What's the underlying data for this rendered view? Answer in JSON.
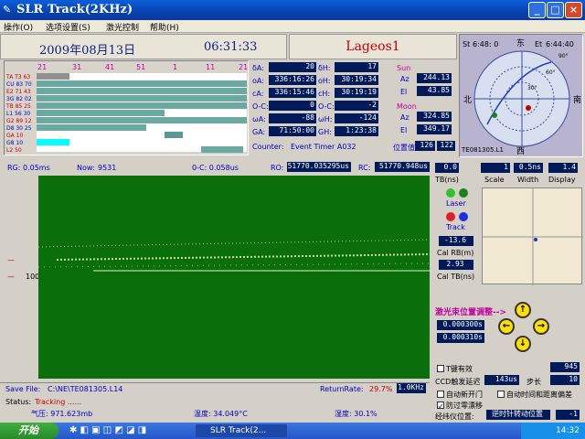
{
  "window": {
    "title": "SLR Track(2KHz)"
  },
  "menu": [
    "操作(O)",
    "选项设置(S)",
    "激光控制",
    "帮助(H)"
  ],
  "header": {
    "date": "2009年08月13日",
    "time": "06:31:33",
    "satellite": "Lageos1"
  },
  "pass_chart": {
    "ticks": [
      "21",
      "31",
      "41",
      "51",
      "1",
      "11",
      "21"
    ],
    "stations": [
      "TA T3 63",
      "CU 83 70",
      "E2 71 43",
      "3G 82 02",
      "TB 85 25",
      "L1 56 30",
      "G2 89 12",
      "D8 30 25",
      "GA 10",
      "G8 10",
      "L2 50"
    ]
  },
  "params": {
    "dA": "20",
    "dH": "17",
    "oA": "336:16:26",
    "oH": "30:19:34",
    "cA": "336:15:46",
    "cH": "30:19:19",
    "OC1": "0",
    "OC2": "-2",
    "wA": "-88",
    "wH": "-124",
    "GA": "71:50:00",
    "GH": "1:23:38",
    "counter_label": "Counter:",
    "counter_value": "Event Timer A032",
    "pos_label": "位置值",
    "pos1": "126",
    "pos2": "122",
    "labels": {
      "dA": "δA:",
      "dH": "δH:",
      "oA": "oA:",
      "oH": "oH:",
      "cA": "cA:",
      "cH": "cH:",
      "OC1": "O-C:",
      "OC2": "O-C:",
      "wA": "ωA:",
      "wH": "ωH:",
      "GA": "GA:",
      "GH": "GH:"
    }
  },
  "sun": {
    "title": "Sun",
    "az_label": "Az",
    "az": "244.13",
    "el_label": "El",
    "el": "43.85"
  },
  "moon": {
    "title": "Moon",
    "az_label": "Az",
    "az": "324.85",
    "el_label": "El",
    "el": "349.17"
  },
  "polar": {
    "st": "St",
    "st_val": "6:48: 0",
    "et": "Et",
    "et_val": "6:44:40",
    "n": "北",
    "s": "南",
    "e": "东",
    "w": "西",
    "footer": "TE081305.L1",
    "rings": [
      "30°",
      "60°",
      "90°"
    ]
  },
  "track_header": {
    "rg": "RG: 0.05ms",
    "now_label": "Now:",
    "now": "9531",
    "oc": "0-C: 0.058us",
    "ro_label": "RO:",
    "ro": "51770.035295us",
    "rc_label": "RC:",
    "rc": "51770.948us"
  },
  "plot": {
    "ytick": "100"
  },
  "right": {
    "tbm": "0.0",
    "scale_v": "1",
    "width_v": "0.5ns",
    "display_v": "1.4",
    "tbm_label": "TB(ns)",
    "scale_label": "Scale",
    "width_label": "Width",
    "display_label": "Display",
    "laser_label": "Laser",
    "track_label": "Track",
    "cal_rb": "-13.6",
    "cal_rb_label": "Cal RB(m)",
    "cal_tb": "2.93",
    "cal_tb_label": "Cal TB(ns)",
    "beam_label": "激光束位置调整-->",
    "beam1": "0.000300s",
    "beam2": "0.000310s",
    "valid_label": "T键有效",
    "valid_val": "945",
    "ccd_label": "CCD触发延迟",
    "ccd_val": "143us",
    "step_label": "步长",
    "step_val": "10",
    "auto1": "自动新开门",
    "auto2": "自动时间和距离偏差",
    "prevent": "防过零漂移",
    "pos_label": "经纬仪位置:",
    "pos_btn": "逆时针转动位置",
    "pos_val": "-1"
  },
  "status": {
    "save_label": "Save File:",
    "save_path": "C:\\NE\\TE081305.L14",
    "return_label": "ReturnRate:",
    "return_val": "29.7%",
    "rate": "1.0KHz",
    "status_label": "Status:",
    "status_val": "Tracking ......",
    "pressure": "气压: 971.623mb",
    "temp": "温度: 34.049°C",
    "humid": "湿度: 30.1%"
  },
  "taskbar": {
    "start": "开始",
    "task": "SLR Track(2...",
    "clock": "14:32"
  },
  "colors": {
    "plot_bg": "#0a6e0a",
    "navy": "#001a5a",
    "accent_red": "#c00000"
  }
}
